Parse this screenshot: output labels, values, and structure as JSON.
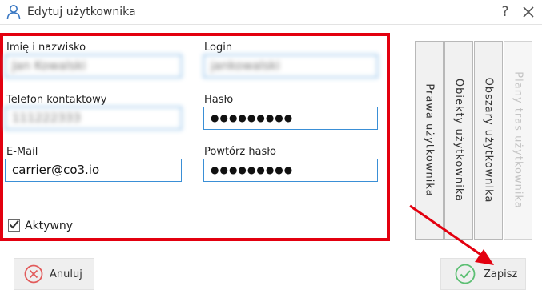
{
  "window": {
    "title": "Edytuj użytkownika",
    "help_label": "?"
  },
  "form": {
    "name_label": "Imię i nazwisko",
    "name_value": "Jan Kowalski",
    "login_label": "Login",
    "login_value": "jankowalski",
    "phone_label": "Telefon kontaktowy",
    "phone_value": "111222333",
    "password_label": "Hasło",
    "password_value": "●●●●●●●●●",
    "email_label": "E-Mail",
    "email_value": "carrier@co3.io",
    "repeat_password_label": "Powtórz hasło",
    "repeat_password_value": "●●●●●●●●●",
    "active_label": "Aktywny",
    "active_checked": true
  },
  "tabs": [
    {
      "label": "Prawa użytkownika",
      "enabled": true
    },
    {
      "label": "Obiekty użytkownika",
      "enabled": true
    },
    {
      "label": "Obszary użytkownika",
      "enabled": true
    },
    {
      "label": "Plany tras użytkownika",
      "enabled": false
    }
  ],
  "buttons": {
    "cancel_label": "Anuluj",
    "save_label": "Zapisz"
  },
  "colors": {
    "highlight": "#e3000f",
    "field_border": "#3a8fd6",
    "cancel_icon": "#e25b5b",
    "save_icon": "#5cbf73"
  }
}
